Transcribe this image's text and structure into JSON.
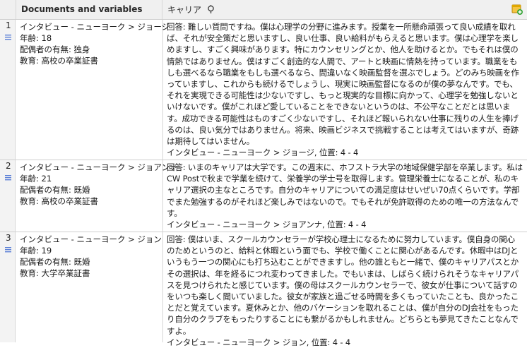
{
  "header": {
    "docs_label": "Documents and variables",
    "career_label": "キャリア"
  },
  "rows": [
    {
      "num": "1",
      "doc_name": "インタビュー - ニューヨーク > ジョージ",
      "age": "年齢: 18",
      "spouse": "配偶者の有無: 独身",
      "education": "教育: 高校の卒業証書",
      "answer": "回答: 難しい質問ですね。僕は心理学の分野に進みます。授業を一所懸命頑張って良い成績を取れば、それが安全策だと思いますし、良い仕事、良い給料がもらえると思います。僕は心理学を楽しめますし、すごく興味があります。特にカウンセリングとか、他人を助けるとか。でもそれは僕の情熱ではありません。僕はすごく創造的な人間で、アートと映画に情熱を持っています。職業をもしも選べるなら職業をもしも選べるなら、間違いなく映画監督を選ぶでしょう。どのみち映画を作っていますし、これからも続けるでしょうし、現実に映画監督になるのが僕の夢なんです。でも、それを実現できる可能性は少ないですし、もっと現実的な目標に向かって、心理学を勉強しないといけないです。僕がこれほど愛していることをできないというのは、不公平なことだとは思います。成功できる可能性はものすごく少ないですし、それほど報いられない仕事に残りの人生を捧げるのは、良い気分ではありません。将来、映画ビジネスで挑戦することは考えてはいますが、奇跡は期待してはいません。",
      "source": "インタビュー - ニューヨーク > ジョージ, 位置: 4 - 4"
    },
    {
      "num": "2",
      "doc_name": "インタビュー - ニューヨーク > ジョアンナ",
      "age": "年齢: 21",
      "spouse": "配偶者の有無: 既婚",
      "education": "教育: 高校の卒業証書",
      "answer": "回答: いまのキャリアは大学です。この週末に、ホフストラ大学の地域保健学部を卒業します。私はCW Postで秋まで学業を続けて、栄養学の学士号を取得します。管理栄養士になることが、私のキャリア選択の主なところです。自分のキャリアについての満足度はせいぜい70点くらいです。学部でまた勉強するのがそれほど楽しみではないので。でもそれが免許取得のための唯一の方法なんです。",
      "source": "インタビュー - ニューヨーク > ジョアンナ, 位置: 4 - 4"
    },
    {
      "num": "3",
      "doc_name": "インタビュー - ニューヨーク > ジョン",
      "age": "年齢: 19",
      "spouse": "配偶者の有無: 既婚",
      "education": "教育: 大学卒業証書",
      "answer": "回答: 僕はいま、スクールカウンセラーが学校心理士になるために努力しています。僕自身の関心のためというのと、給料と休暇という面でも、学校で働くことに関心があるんです。休暇中はDJというもう一つの関心にも打ち込むことができますし。他の誰ともと一緒で、僕のキャリアパスとかその選択は、年を経るにつれ変わってきました。でもいまは、しばらく続けられそうなキャリアパスを見つけられたと感じています。僕の母はスクールカウンセラーで、彼女が仕事について話すのをいつも楽しく聞いていました。彼女が家族と過ごせる時間を多くもっていたことも、良かったことだと覚えています。夏休みとか、他のバケーションを取れることは、僕が自分のDJ会社をもったり自分のクラブをもったりすることにも繋がるかもしれません。どちらとも夢見てきたことなんですよ。",
      "source": "インタビュー - ニューヨーク > ジョン, 位置: 4 - 4"
    }
  ]
}
